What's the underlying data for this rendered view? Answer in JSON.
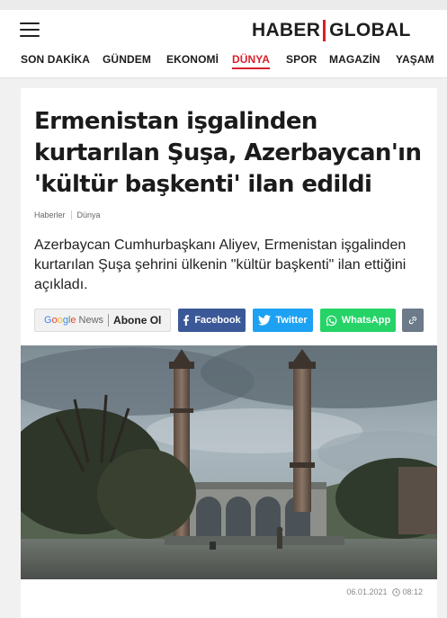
{
  "brand": {
    "left": "HABER",
    "right": "GLOBAL",
    "accent": "#d81f2a"
  },
  "nav": [
    {
      "label": "SON DAKİKA",
      "active": false
    },
    {
      "label": "GÜNDEM",
      "active": false
    },
    {
      "label": "EKONOMİ",
      "active": false
    },
    {
      "label": "DÜNYA",
      "active": true
    },
    {
      "label": "SPOR",
      "active": false
    },
    {
      "label": "MAGAZİN",
      "active": false
    },
    {
      "label": "YAŞAM",
      "active": false
    }
  ],
  "article": {
    "title": "Ermenistan işgalinden kurtarılan Şuşa, Azerbaycan'ın 'kültür başkenti' ilan edildi",
    "breadcrumb": [
      "Haberler",
      "Dünya"
    ],
    "summary": "Azerbaycan Cumhurbaşkanı Aliyev, Ermenistan işgalinden kurtarılan Şuşa şehrini ülkenin \"kültür başkenti\" ilan ettiğini açıkladı.",
    "date": "06.01.2021",
    "time": "08:12"
  },
  "share": {
    "google_news": {
      "google": "Google",
      "news": "News",
      "follow": "Abone Ol"
    },
    "facebook": "Facebook",
    "twitter": "Twitter",
    "whatsapp": "WhatsApp",
    "colors": {
      "facebook": "#3b5998",
      "twitter": "#1da1f2",
      "whatsapp": "#25d366",
      "link": "#6c7a89"
    }
  },
  "icons": {
    "menu": "hamburger-icon",
    "facebook": "facebook-icon",
    "twitter": "twitter-icon",
    "whatsapp": "whatsapp-icon",
    "link": "link-icon",
    "clock": "clock-icon"
  }
}
